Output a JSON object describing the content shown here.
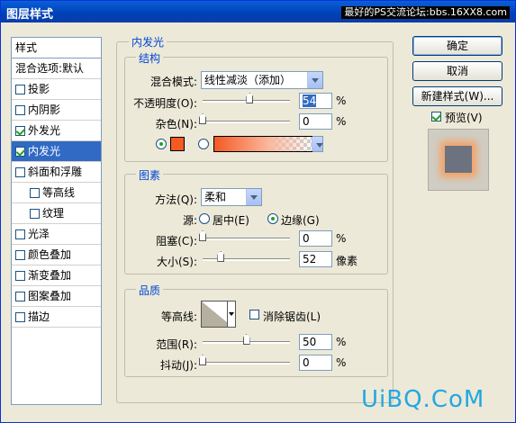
{
  "window": {
    "title": "图层样式",
    "watermark_top": "最好的PS交流论坛:bbs.16XX8.com"
  },
  "sidebar": {
    "header": "样式",
    "items": [
      {
        "label": "混合选项:默认",
        "checkbox": false,
        "checked": false,
        "selected": false
      },
      {
        "label": "投影",
        "checkbox": true,
        "checked": false,
        "selected": false
      },
      {
        "label": "内阴影",
        "checkbox": true,
        "checked": false,
        "selected": false
      },
      {
        "label": "外发光",
        "checkbox": true,
        "checked": true,
        "selected": false
      },
      {
        "label": "内发光",
        "checkbox": true,
        "checked": true,
        "selected": true
      },
      {
        "label": "斜面和浮雕",
        "checkbox": true,
        "checked": false,
        "selected": false
      },
      {
        "label": "等高线",
        "checkbox": true,
        "checked": false,
        "selected": false,
        "sub": true
      },
      {
        "label": "纹理",
        "checkbox": true,
        "checked": false,
        "selected": false,
        "sub": true
      },
      {
        "label": "光泽",
        "checkbox": true,
        "checked": false,
        "selected": false
      },
      {
        "label": "颜色叠加",
        "checkbox": true,
        "checked": false,
        "selected": false
      },
      {
        "label": "渐变叠加",
        "checkbox": true,
        "checked": false,
        "selected": false
      },
      {
        "label": "图案叠加",
        "checkbox": true,
        "checked": false,
        "selected": false
      },
      {
        "label": "描边",
        "checkbox": true,
        "checked": false,
        "selected": false
      }
    ]
  },
  "panel": {
    "title": "内发光"
  },
  "structure": {
    "title": "结构",
    "blend_mode_label": "混合模式:",
    "blend_mode_value": "线性减淡（添加）",
    "opacity_label": "不透明度(O):",
    "opacity_value": "54",
    "opacity_unit": "%",
    "opacity_fraction": 0.54,
    "noise_label": "杂色(N):",
    "noise_value": "0",
    "noise_unit": "%",
    "noise_fraction": 0,
    "glow_color": "#f55a22"
  },
  "elements": {
    "title": "图素",
    "method_label": "方法(Q):",
    "method_value": "柔和",
    "source_label": "源:",
    "source_center": "居中(E)",
    "source_edge": "边缘(G)",
    "choke_label": "阻塞(C):",
    "choke_value": "0",
    "choke_unit": "%",
    "choke_fraction": 0,
    "size_label": "大小(S):",
    "size_value": "52",
    "size_unit": "像素",
    "size_fraction": 0.21
  },
  "quality": {
    "title": "品质",
    "contour_label": "等高线:",
    "antialias_label": "消除锯齿(L)",
    "range_label": "范围(R):",
    "range_value": "50",
    "range_unit": "%",
    "range_fraction": 0.5,
    "jitter_label": "抖动(J):",
    "jitter_value": "0",
    "jitter_unit": "%",
    "jitter_fraction": 0
  },
  "buttons": {
    "ok": "确定",
    "cancel": "取消",
    "new_style": "新建样式(W)...",
    "preview": "预览(V)"
  },
  "watermark": "UiBQ.CoM"
}
